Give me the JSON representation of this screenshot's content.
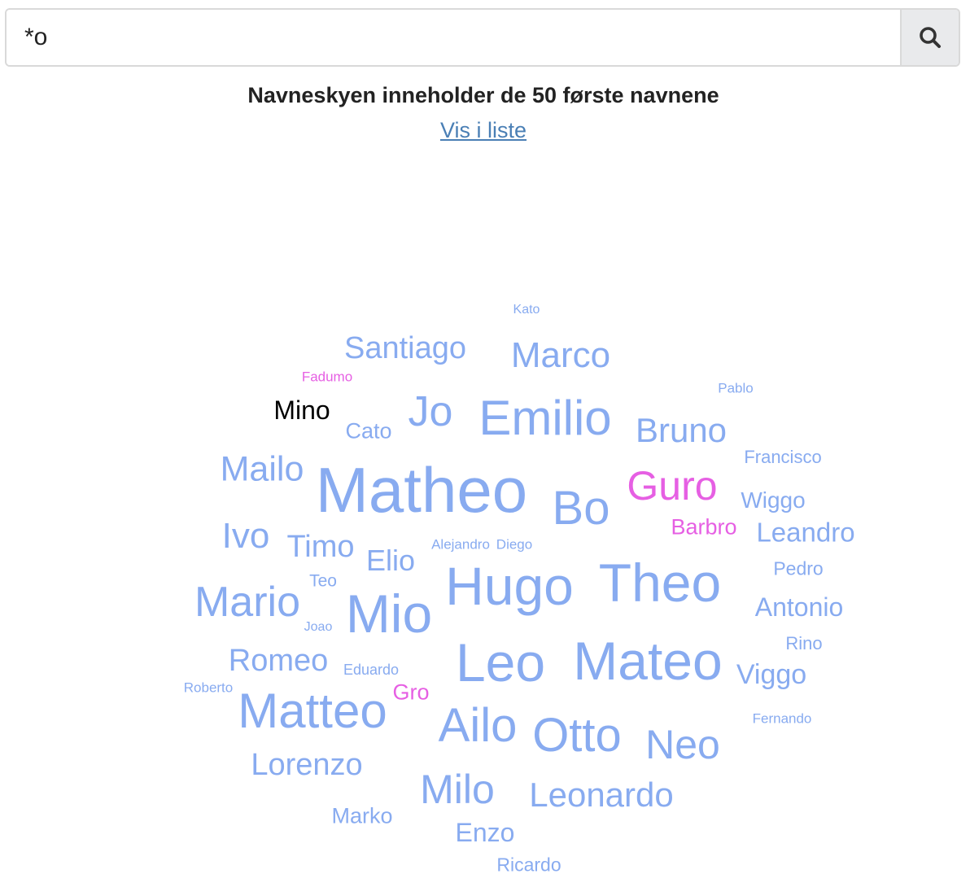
{
  "search": {
    "value": "*o",
    "button_icon": "search-icon"
  },
  "heading": "Navneskyen inneholder de 50 første navnene",
  "list_link": "Vis i liste",
  "colors": {
    "male": "#88abf0",
    "female": "#e65fe3",
    "highlight": "#000000",
    "link": "#4a7fb5"
  },
  "words": [
    {
      "text": "Kato",
      "gender": "male"
    },
    {
      "text": "Santiago",
      "gender": "male"
    },
    {
      "text": "Marco",
      "gender": "male"
    },
    {
      "text": "Fadumo",
      "gender": "female"
    },
    {
      "text": "Pablo",
      "gender": "male"
    },
    {
      "text": "Mino",
      "gender": "highlight"
    },
    {
      "text": "Jo",
      "gender": "male"
    },
    {
      "text": "Emilio",
      "gender": "male"
    },
    {
      "text": "Cato",
      "gender": "male"
    },
    {
      "text": "Bruno",
      "gender": "male"
    },
    {
      "text": "Francisco",
      "gender": "male"
    },
    {
      "text": "Mailo",
      "gender": "male"
    },
    {
      "text": "Matheo",
      "gender": "male"
    },
    {
      "text": "Guro",
      "gender": "female"
    },
    {
      "text": "Bo",
      "gender": "male"
    },
    {
      "text": "Wiggo",
      "gender": "male"
    },
    {
      "text": "Barbro",
      "gender": "female"
    },
    {
      "text": "Ivo",
      "gender": "male"
    },
    {
      "text": "Leandro",
      "gender": "male"
    },
    {
      "text": "Timo",
      "gender": "male"
    },
    {
      "text": "Alejandro",
      "gender": "male"
    },
    {
      "text": "Diego",
      "gender": "male"
    },
    {
      "text": "Elio",
      "gender": "male"
    },
    {
      "text": "Pedro",
      "gender": "male"
    },
    {
      "text": "Teo",
      "gender": "male"
    },
    {
      "text": "Hugo",
      "gender": "male"
    },
    {
      "text": "Theo",
      "gender": "male"
    },
    {
      "text": "Mario",
      "gender": "male"
    },
    {
      "text": "Antonio",
      "gender": "male"
    },
    {
      "text": "Mio",
      "gender": "male"
    },
    {
      "text": "Joao",
      "gender": "male"
    },
    {
      "text": "Rino",
      "gender": "male"
    },
    {
      "text": "Romeo",
      "gender": "male"
    },
    {
      "text": "Leo",
      "gender": "male"
    },
    {
      "text": "Mateo",
      "gender": "male"
    },
    {
      "text": "Eduardo",
      "gender": "male"
    },
    {
      "text": "Viggo",
      "gender": "male"
    },
    {
      "text": "Roberto",
      "gender": "male"
    },
    {
      "text": "Gro",
      "gender": "female"
    },
    {
      "text": "Matteo",
      "gender": "male"
    },
    {
      "text": "Fernando",
      "gender": "male"
    },
    {
      "text": "Ailo",
      "gender": "male"
    },
    {
      "text": "Otto",
      "gender": "male"
    },
    {
      "text": "Neo",
      "gender": "male"
    },
    {
      "text": "Lorenzo",
      "gender": "male"
    },
    {
      "text": "Milo",
      "gender": "male"
    },
    {
      "text": "Leonardo",
      "gender": "male"
    },
    {
      "text": "Marko",
      "gender": "male"
    },
    {
      "text": "Enzo",
      "gender": "male"
    },
    {
      "text": "Ricardo",
      "gender": "male"
    }
  ]
}
